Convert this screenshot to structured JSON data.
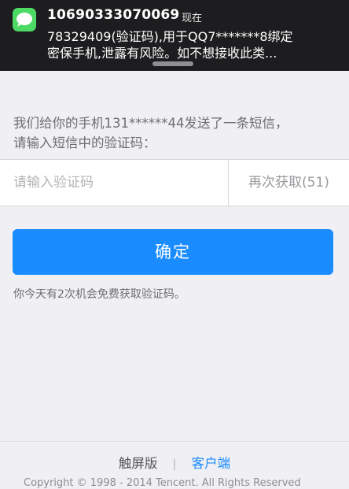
{
  "notification": {
    "app_icon": "messages-icon",
    "sender": "10690333070069",
    "time": "现在",
    "body_line1": "78329409(验证码),用于QQ7*******8绑定",
    "body_line2": "密保手机,泄露有风险。如不想接收此类...",
    "icon_color": "#4cd964"
  },
  "prompt": {
    "line1": "我们给你的手机131******44发送了一条短信，",
    "line2": "请输入短信中的验证码："
  },
  "code_input": {
    "placeholder": "请输入验证码",
    "value": ""
  },
  "resend_label": "再次获取(51)",
  "confirm_label": "确定",
  "note": "你今天有2次机会免费获取验证码。",
  "footer": {
    "touch_label": "触屏版",
    "separator": "|",
    "client_label": "客户端",
    "copyright": "Copyright © 1998 - 2014 Tencent. All Rights Reserved"
  },
  "colors": {
    "accent": "#1a8cff",
    "background": "#efeff4"
  }
}
